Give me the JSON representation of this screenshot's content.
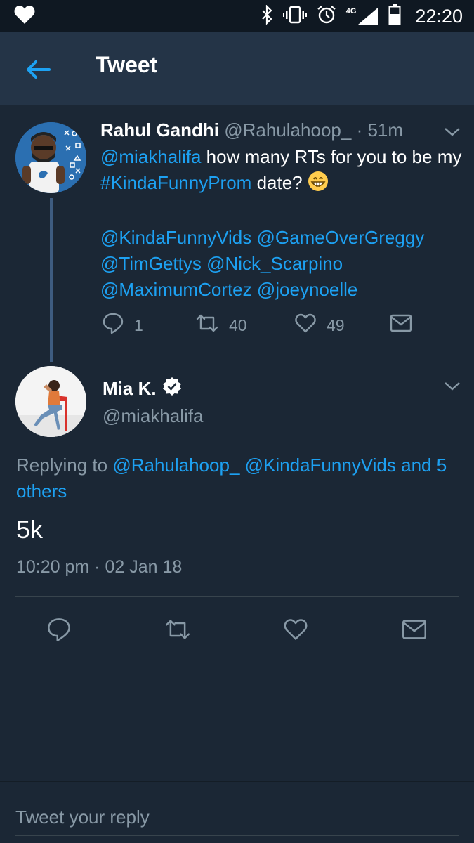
{
  "status_bar": {
    "time": "22:20",
    "network": "4G"
  },
  "header": {
    "title": "Tweet"
  },
  "parent_tweet": {
    "name": "Rahul Gandhi",
    "handle": "@Rahulahoop_",
    "time": "· 51m",
    "text": {
      "mention": "@miakhalifa",
      "part1": " how many RTs for you to be my ",
      "hashtag": "#KindaFunnyProm",
      "part2": " date? ",
      "mentions_line1": "@KindaFunnyVids @GameOverGreggy",
      "mentions_line2": "@TimGettys @Nick_Scarpino",
      "mentions_line3": "@MaximumCortez @joeynoelle"
    },
    "reply_count": "1",
    "retweet_count": "40",
    "like_count": "49"
  },
  "main_tweet": {
    "name": "Mia K.",
    "handle": "@miakhalifa",
    "replying_prefix": "Replying to ",
    "replying_to_user": "@Rahulahoop_",
    "replying_to_others": "@KindaFunnyVids and 5 others",
    "text": "5k",
    "timestamp": "10:20 pm · 02 Jan 18"
  },
  "reply_input": {
    "placeholder": "Tweet your reply"
  },
  "icons": {
    "status_left": "heart-icon",
    "status_right": [
      "bluetooth-icon",
      "vibrate-icon",
      "alarm-icon",
      "signal-icon",
      "battery-icon"
    ],
    "back": "arrow-left-icon",
    "caret": "chevron-down-icon",
    "actions": [
      "reply-icon",
      "retweet-icon",
      "like-icon",
      "message-icon"
    ],
    "verified": "verified-badge-icon"
  },
  "colors": {
    "background": "#1b2735",
    "appbar": "#243447",
    "accent": "#1da1f2",
    "muted_text": "#8899a6"
  }
}
